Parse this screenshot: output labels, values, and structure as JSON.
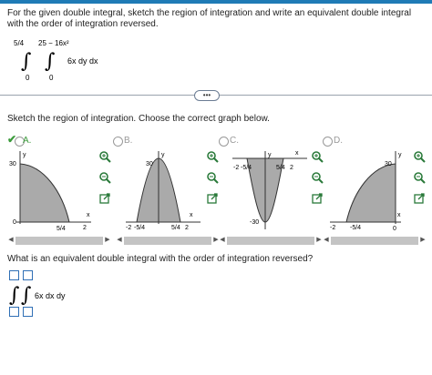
{
  "prompt": "For the given double integral, sketch the region of integration and write an equivalent double integral with the order of integration reversed.",
  "integral": {
    "outer_upper": "5/4",
    "inner_upper": "25 − 16x²",
    "outer_lower": "0",
    "inner_lower": "0",
    "integrand": "6x dy dx"
  },
  "more_button": "•••",
  "sketch_instruction": "Sketch the region of integration. Choose the correct graph below.",
  "options": [
    {
      "label": "A.",
      "selected": true
    },
    {
      "label": "B.",
      "selected": false
    },
    {
      "label": "C.",
      "selected": false
    },
    {
      "label": "D.",
      "selected": false
    }
  ],
  "graph_labels": {
    "y": "y",
    "x": "x",
    "thirty": "30",
    "zero": "0",
    "five_fourths": "5/4",
    "neg_five_fourths": "-5/4",
    "two": "2",
    "neg_two": "-2",
    "neg_thirty": "-30"
  },
  "reverse_question": "What is an equivalent double integral with the order of integration reversed?",
  "answer_integrand": "6x dx dy",
  "icons": [
    "zoom-in-icon",
    "zoom-out-icon",
    "popout-icon",
    "check-icon"
  ],
  "colors": {
    "accent": "#1f7bb6",
    "region_fill": "#aaaaaa",
    "check": "#3a9a3a"
  }
}
